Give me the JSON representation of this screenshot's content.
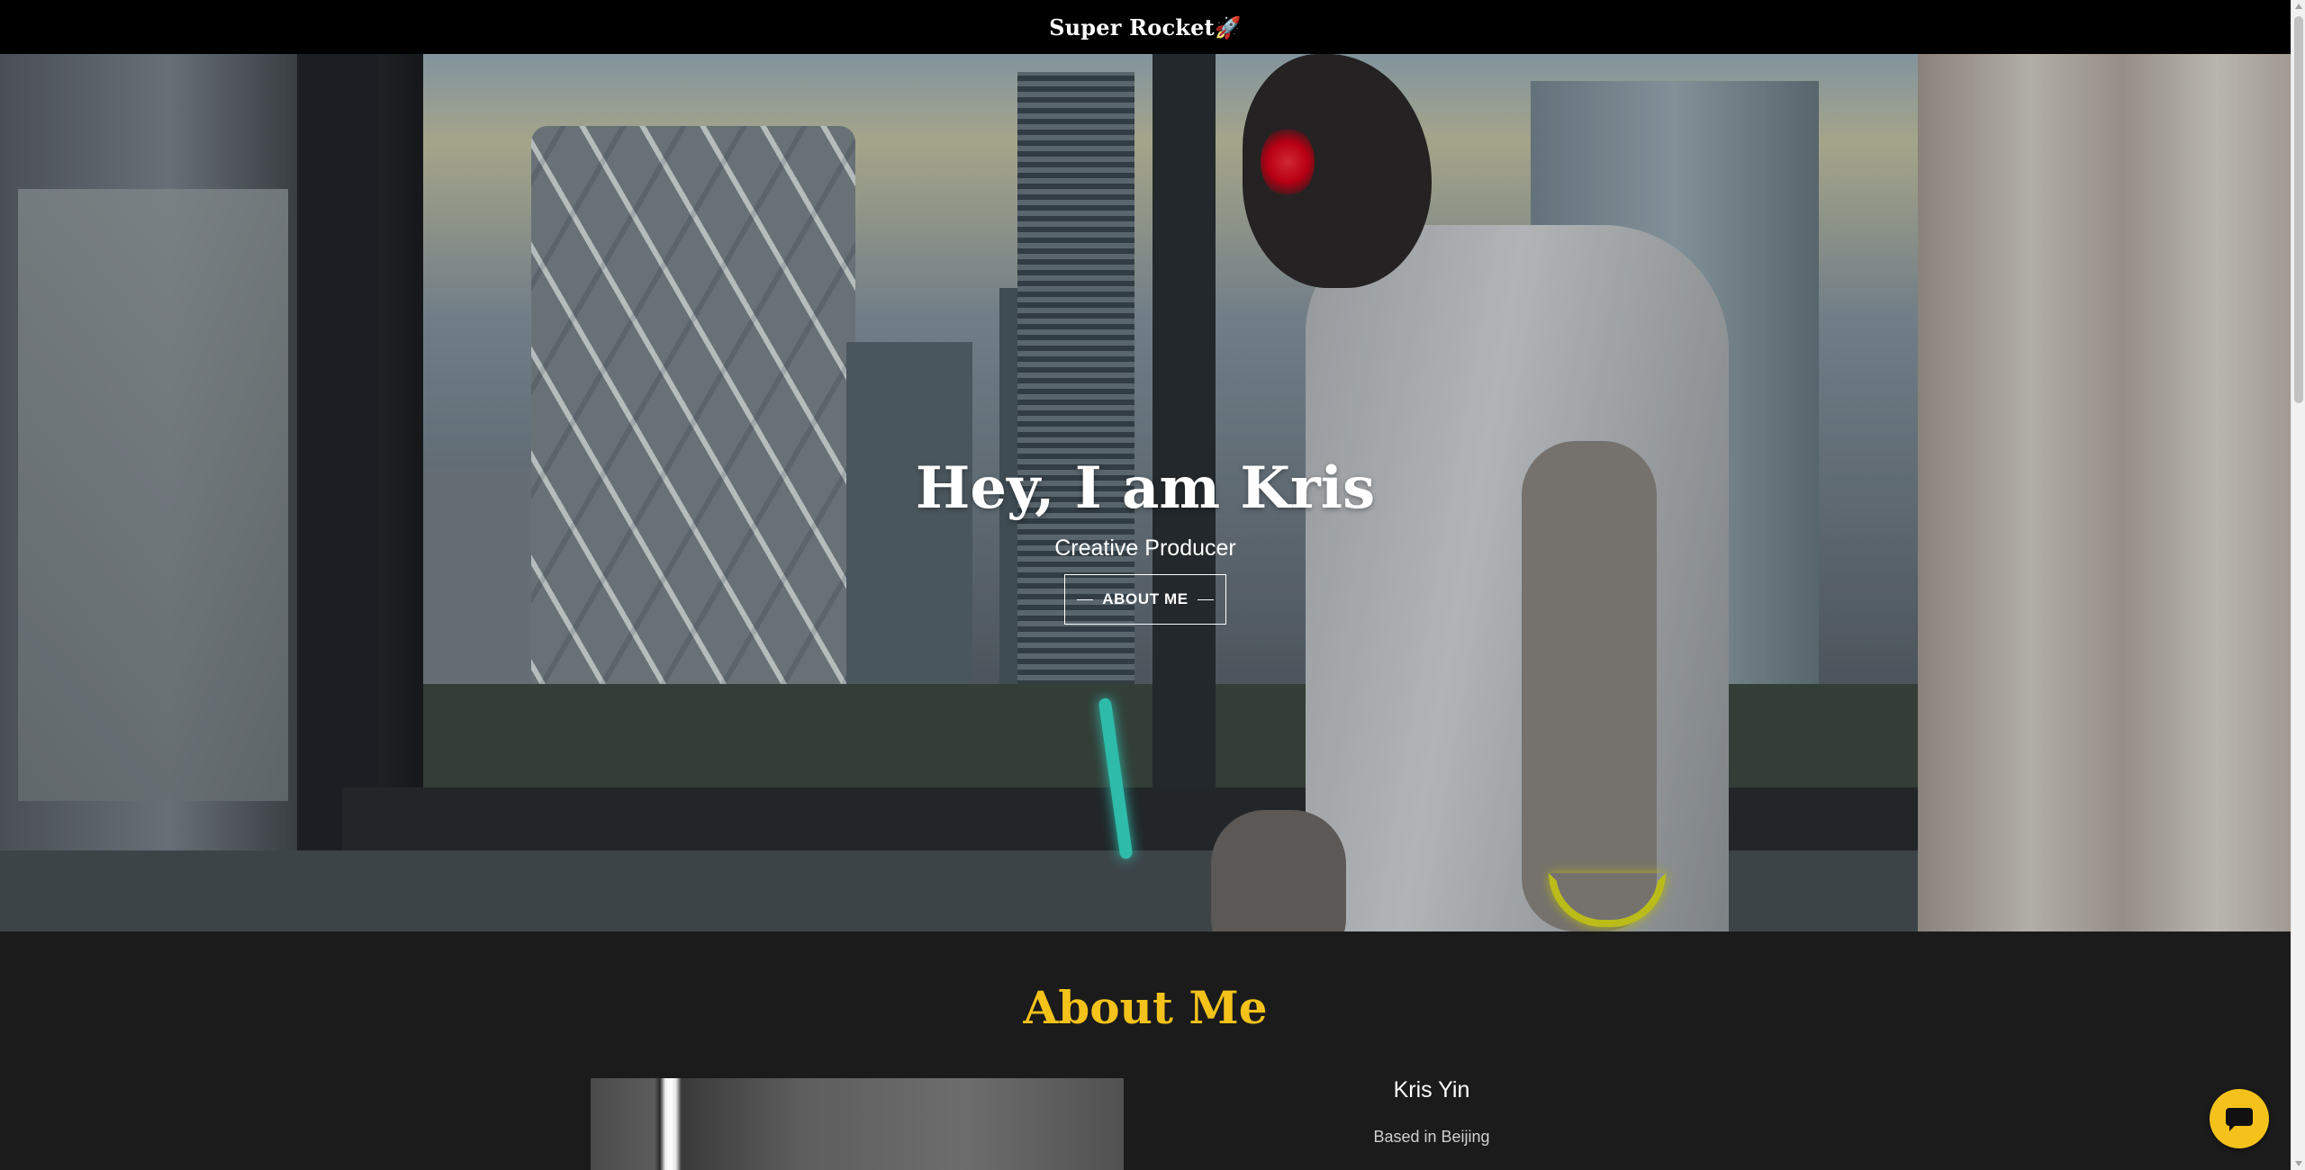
{
  "header": {
    "brand": "Super Rocket🚀"
  },
  "hero": {
    "title": "Hey, I am Kris",
    "subtitle": "Creative Producer",
    "button_label": "ABOUT ME"
  },
  "about": {
    "heading": "About Me",
    "name": "Kris Yin",
    "location": "Based in Beijing"
  },
  "chat": {
    "icon": "chat-bubble-icon"
  },
  "colors": {
    "accent": "#f4c21b",
    "header_bg": "#000000",
    "page_bg": "#1b1b1b"
  }
}
